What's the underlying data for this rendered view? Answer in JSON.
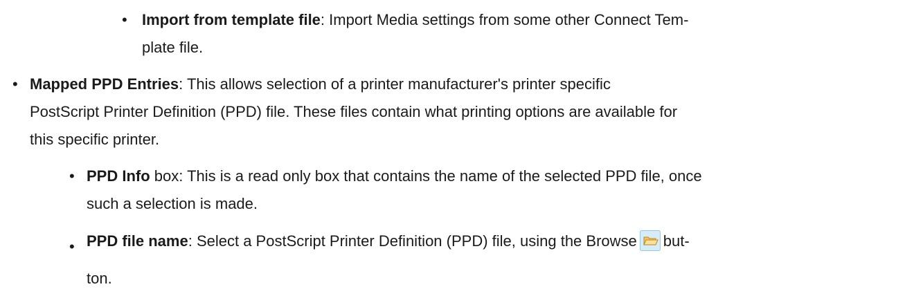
{
  "items": {
    "import_template": {
      "term": "Import from template file",
      "line1": ": Import Media settings from some other Connect Tem-",
      "line2": "plate file."
    },
    "mapped_ppd": {
      "term": "Mapped PPD Entries",
      "line1": ": This allows selection of a printer manufacturer's printer specific",
      "line2": "PostScript Printer Definition (PPD) file. These files contain what printing options are available for",
      "line3": "this specific printer."
    },
    "ppd_info": {
      "term": "PPD Info",
      "line1": " box: This is a read only box that contains the name of the selected PPD file, once",
      "line2": "such a selection is made."
    },
    "ppd_file_name": {
      "term": "PPD file name",
      "line1_before_icon": ": Select a PostScript Printer Definition (PPD) file, using the Browse",
      "line1_after_icon": "but-",
      "line2": "ton."
    }
  },
  "bullet_glyph": "•",
  "icons": {
    "browse": "folder-open-icon"
  }
}
